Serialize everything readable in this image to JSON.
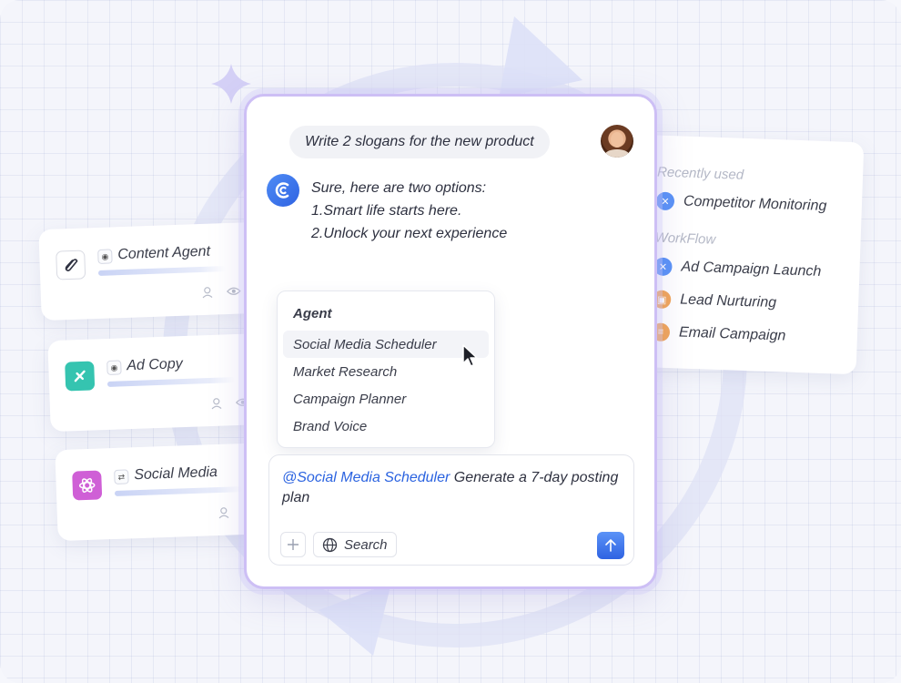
{
  "left_cards": [
    {
      "title": "Content Agent"
    },
    {
      "title": "Ad Copy"
    },
    {
      "title": "Social Media"
    }
  ],
  "right_panel": {
    "recent_label": "Recently used",
    "recent_items": [
      "Competitor Monitoring"
    ],
    "workflow_label": "WorkFlow",
    "workflow_items": [
      "Ad Campaign Launch",
      "Lead Nurturing",
      "Email Campaign"
    ]
  },
  "chat": {
    "user_message": "Write 2 slogans for the new product",
    "bot_lines": [
      "Sure, here are two options:",
      "1.Smart life starts here.",
      "2.Unlock your next experience"
    ]
  },
  "agent_dropdown": {
    "title": "Agent",
    "options": [
      "Social Media Scheduler",
      "Market Research",
      "Campaign Planner",
      "Brand Voice"
    ],
    "highlighted": "Social Media Scheduler"
  },
  "composer": {
    "mention": "@Social Media Scheduler",
    "text": " Generate a 7-day posting plan",
    "search_label": "Search"
  },
  "colors": {
    "accent": "#2f63e2",
    "panel_border": "#cdbff5",
    "workflow_blue": "#5b93f7",
    "workflow_orange": "#f2a65a"
  }
}
